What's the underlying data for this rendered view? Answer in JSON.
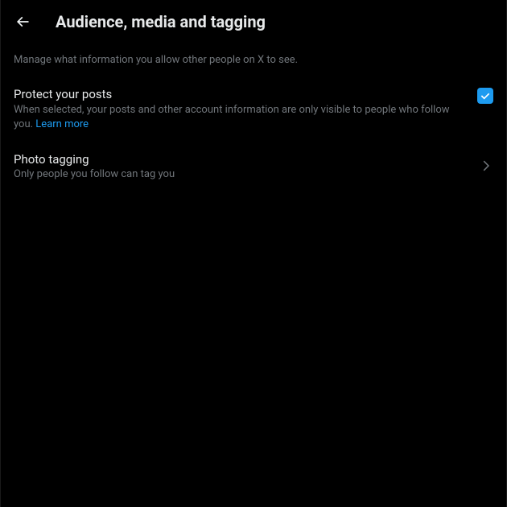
{
  "header": {
    "title": "Audience, media and tagging"
  },
  "description": "Manage what information you allow other people on X to see.",
  "protect": {
    "title": "Protect your posts",
    "desc_prefix": "When selected, your posts and other account information are only visible to people who follow you. ",
    "learn_more": "Learn more",
    "checked": true
  },
  "photo_tagging": {
    "title": "Photo tagging",
    "desc": "Only people you follow can tag you"
  }
}
